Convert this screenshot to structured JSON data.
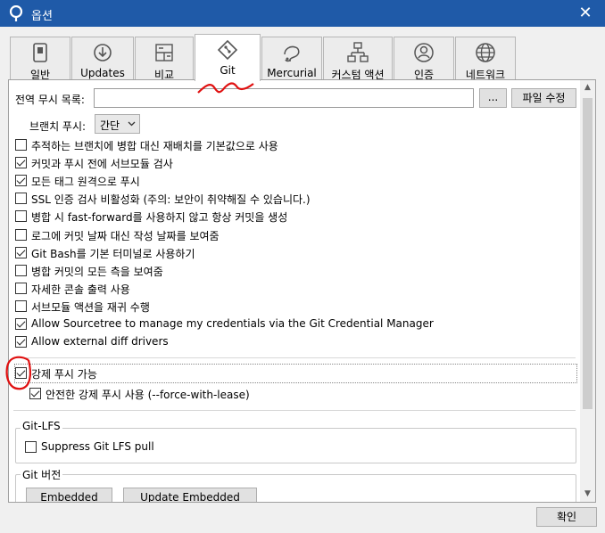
{
  "window": {
    "title": "옵션",
    "close_glyph": "✕"
  },
  "tabs": [
    {
      "label": "일반",
      "icon": "switch-icon"
    },
    {
      "label": "Updates",
      "icon": "download-icon"
    },
    {
      "label": "비교",
      "icon": "compare-icon"
    },
    {
      "label": "Git",
      "icon": "git-icon",
      "active": true
    },
    {
      "label": "Mercurial",
      "icon": "mercurial-icon"
    },
    {
      "label": "커스텀 액션",
      "icon": "custom-actions-icon"
    },
    {
      "label": "인증",
      "icon": "account-icon"
    },
    {
      "label": "네트워크",
      "icon": "globe-icon"
    }
  ],
  "git": {
    "global_ignore_label": "전역 무시 목록:",
    "global_ignore_value": "",
    "browse_label": "...",
    "edit_file_label": "파일 수정",
    "branch_push_label": "브랜치 푸시:",
    "branch_push_value": "간단",
    "options": [
      {
        "label": "추적하는 브랜치에 병합 대신 재배치를 기본값으로 사용",
        "checked": false
      },
      {
        "label": "커밋과 푸시 전에 서브모듈 검사",
        "checked": true
      },
      {
        "label": "모든 태그 원격으로 푸시",
        "checked": true
      },
      {
        "label": "SSL 인증 검사 비활성화 (주의: 보안이 취약해질 수 있습니다.)",
        "checked": false
      },
      {
        "label": "병합 시 fast-forward를 사용하지 않고 항상 커밋을 생성",
        "checked": false
      },
      {
        "label": "로그에 커밋 날짜 대신 작성 날짜를 보여줌",
        "checked": false
      },
      {
        "label": "Git Bash를 기본 터미널로 사용하기",
        "checked": true
      },
      {
        "label": "병합 커밋의 모든 측을 보여줌",
        "checked": false
      },
      {
        "label": "자세한 콘솔 출력 사용",
        "checked": false
      },
      {
        "label": "서브모듈 액션을 재귀 수행",
        "checked": false
      },
      {
        "label": "Allow Sourcetree to manage my credentials via the Git Credential Manager",
        "checked": true
      },
      {
        "label": "Allow external diff drivers",
        "checked": true
      }
    ],
    "force_push": {
      "label": "강제 푸시 가능",
      "checked": true
    },
    "safe_force_push": {
      "label": "안전한 강제 푸시 사용 (--force-with-lease)",
      "checked": true
    },
    "lfs_group_title": "Git-LFS",
    "lfs_suppress": {
      "label": "Suppress Git LFS pull",
      "checked": false
    },
    "git_version_title": "Git 버전",
    "embedded_label": "Embedded",
    "update_embedded_label": "Update Embedded"
  },
  "footer": {
    "ok_label": "확인"
  },
  "colors": {
    "titlebar": "#1f5aa8",
    "annotation": "#e01010"
  }
}
